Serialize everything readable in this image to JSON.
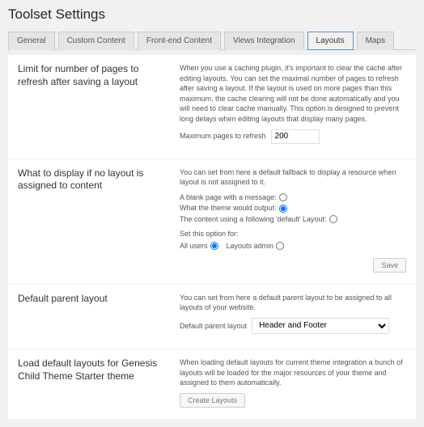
{
  "page_title": "Toolset Settings",
  "tabs": {
    "general": "General",
    "custom_content": "Custom Content",
    "frontend_content": "Front-end Content",
    "views_integration": "Views Integration",
    "layouts": "Layouts",
    "maps": "Maps"
  },
  "sections": {
    "limit": {
      "title": "Limit for number of pages to refresh after saving a layout",
      "desc": "When you use a caching plugin, it's important to clear the cache after editing layouts. You can set the maximal number of pages to refresh after saving a layout. If the layout is used on more pages than this maximum, the cache clearing will not be done automatically and you will need to clear cache manually. This option is designed to prevent long delays when editing layouts that display many pages.",
      "field_label": "Maximum pages to refresh",
      "field_value": "200"
    },
    "fallback": {
      "title": "What to display if no layout is assigned to content",
      "desc": "You can set from here a default fallback to display a resource when layout is not assigned to it.",
      "opt_blank": "A blank page with a message:",
      "opt_theme": "What the theme would output:",
      "opt_default": "The content using a following 'default' Layout:",
      "set_for_label": "Set this option for:",
      "users_all": "All users",
      "users_admin": "Layouts admin",
      "save_btn": "Save"
    },
    "parent": {
      "title": "Default parent layout",
      "desc": "You can set from here a default parent layout to be assigned to all layouts of your website.",
      "field_label": "Default parent layout",
      "select_value": "Header and Footer"
    },
    "defaults": {
      "title": "Load default layouts for Genesis Child Theme Starter theme",
      "desc": "When loading default layouts for current theme integration a bunch of layouts will be loaded for the major resources of your theme and assigned to them automatically.",
      "btn": "Create Layouts"
    }
  }
}
